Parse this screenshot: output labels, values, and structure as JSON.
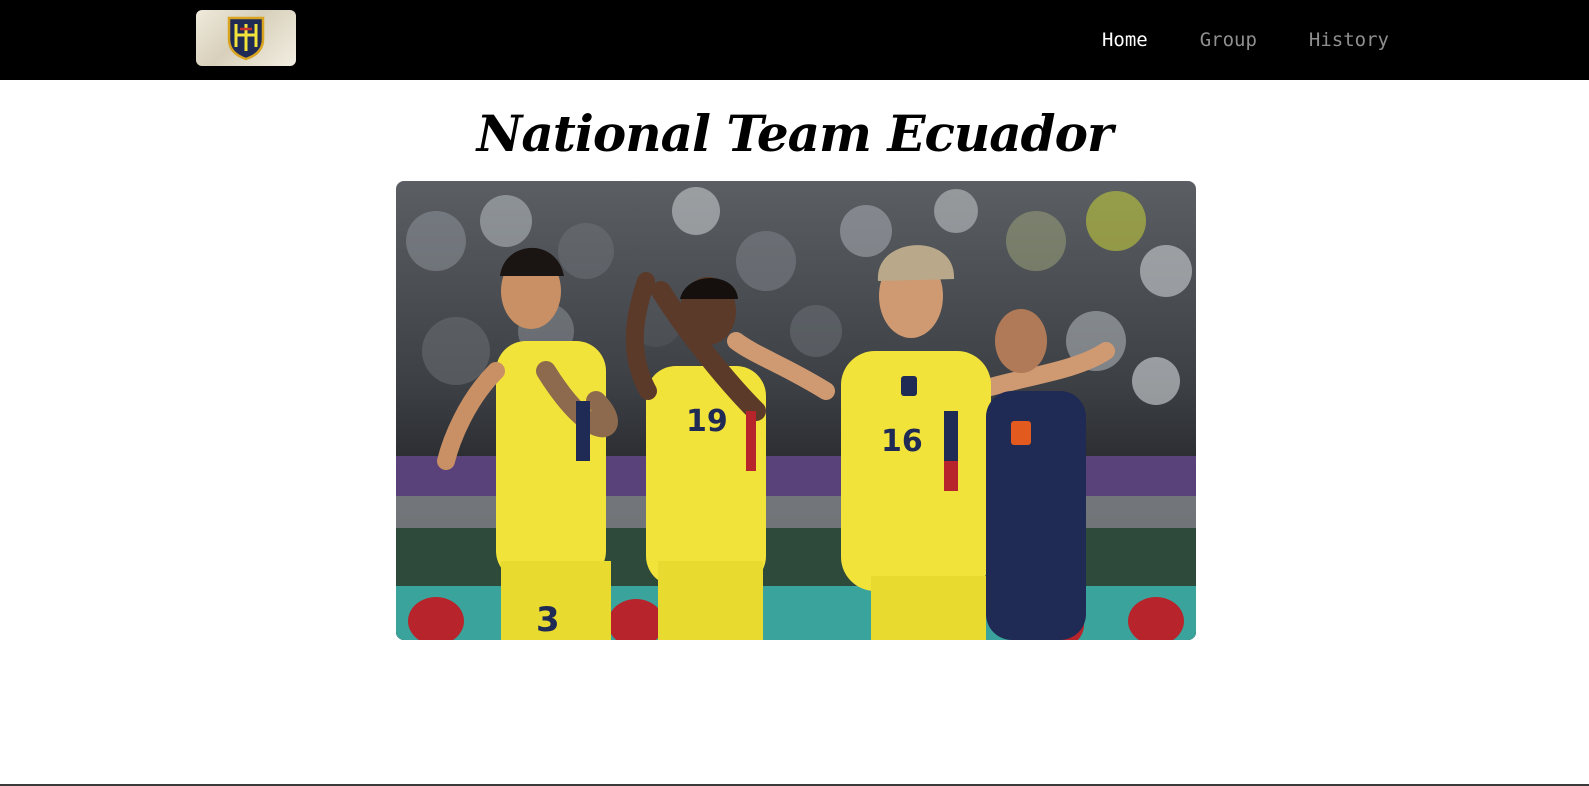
{
  "header": {
    "logo_icon": "ecuador-federation-crest-icon",
    "nav": [
      {
        "label": "Home",
        "active": true
      },
      {
        "label": "Group",
        "active": false
      },
      {
        "label": "History",
        "active": false
      }
    ]
  },
  "main": {
    "title": "National Team Ecuador",
    "hero_image": {
      "content": "ecuador-players-celebrating-photo",
      "jersey_numbers": [
        "3",
        "19",
        "16"
      ]
    }
  },
  "colors": {
    "navbar": "#000000",
    "nav_active": "#ffffff",
    "nav_inactive": "#8f8f8f",
    "jersey_yellow": "#f2e33a",
    "jersey_navy": "#1f2a55"
  }
}
